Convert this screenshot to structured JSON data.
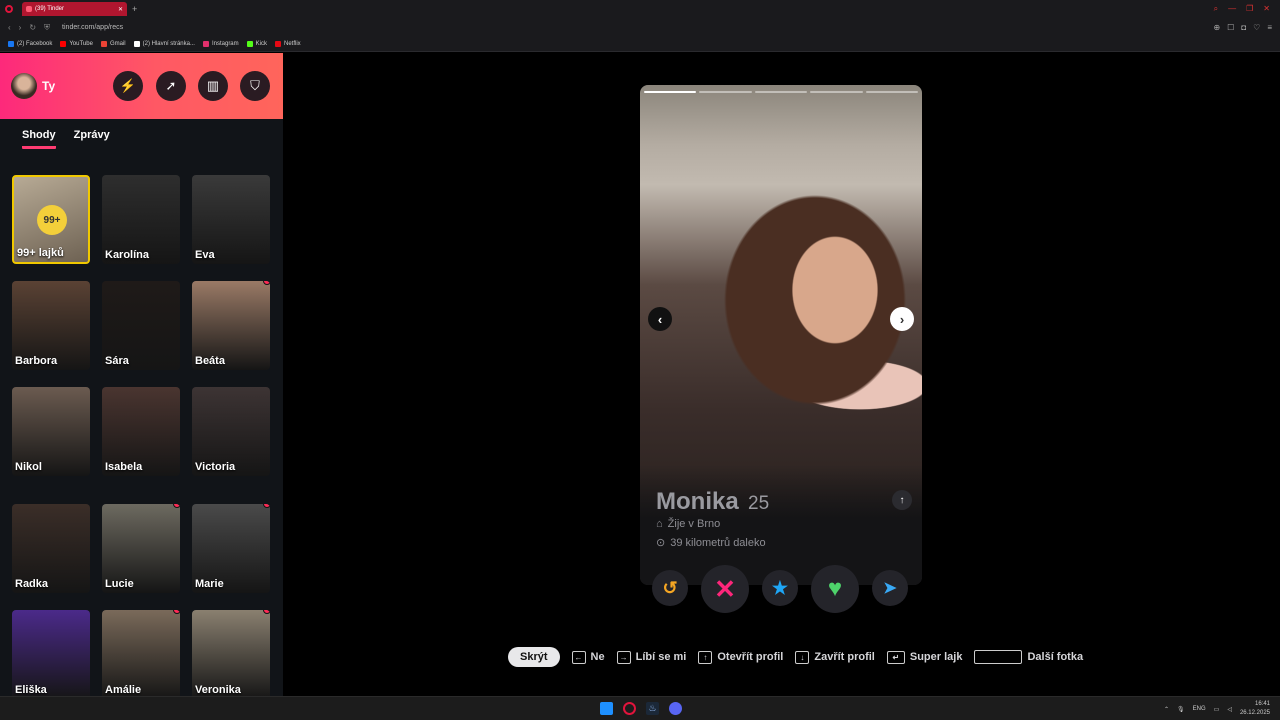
{
  "browser": {
    "tab_title": "(39) Tinder",
    "url": "tinder.com/app/recs",
    "bookmarks": [
      {
        "label": "(2) Facebook",
        "color": "#1877f2"
      },
      {
        "label": "YouTube",
        "color": "#ff0000"
      },
      {
        "label": "Gmail",
        "color": "#ea4335"
      },
      {
        "label": "(2) Hlavní stránka...",
        "color": "#ffffff"
      },
      {
        "label": "Instagram",
        "color": "#e1306c"
      },
      {
        "label": "Kick",
        "color": "#53fc18"
      },
      {
        "label": "Netflix",
        "color": "#e50914"
      }
    ]
  },
  "sidebar": {
    "user_name": "Ty",
    "tabs": [
      "Shody",
      "Zprávy"
    ],
    "likes_badge": "99+",
    "likes_label": "99+ lajků",
    "matches": [
      "Karolína",
      "Eva",
      "Barbora",
      "Sára",
      "Beáta",
      "Nikol",
      "Isabela",
      "Victoria",
      "Radka",
      "Lucie",
      "Marie",
      "Eliška",
      "Amálie",
      "Veronika"
    ]
  },
  "profile": {
    "name": "Monika",
    "age": "25",
    "location": "Žije v Brno",
    "distance": "39 kilometrů daleko"
  },
  "shortcuts": {
    "hide": "Skrýt",
    "no": "Ne",
    "like": "Líbí se mi",
    "open": "Otevřít profil",
    "close": "Zavřít profil",
    "super": "Super lajk",
    "next": "Další fotka"
  },
  "taskbar": {
    "lang": "ENG",
    "time": "16:41",
    "date": "26.12.2025"
  }
}
